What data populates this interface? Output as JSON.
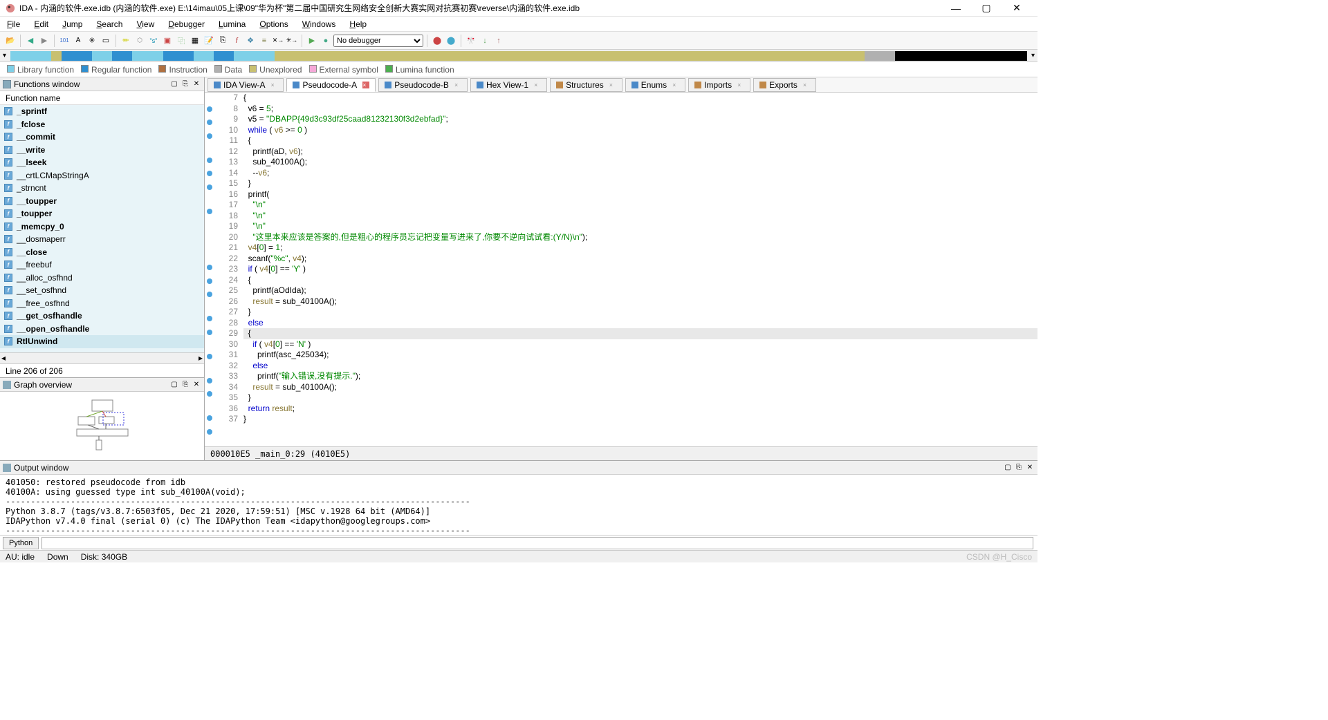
{
  "title": "IDA - 内涵的软件.exe.idb (内涵的软件.exe) E:\\14imau\\05上课\\09\"华为杯\"第二届中国研究生网络安全创新大赛实网对抗赛初赛\\reverse\\内涵的软件.exe.idb",
  "menu": [
    "File",
    "Edit",
    "Jump",
    "Search",
    "View",
    "Debugger",
    "Lumina",
    "Options",
    "Windows",
    "Help"
  ],
  "debugger_sel": "No debugger",
  "legend": [
    {
      "c": "#7ed0e8",
      "t": "Library function"
    },
    {
      "c": "#2f8fd0",
      "t": "Regular function"
    },
    {
      "c": "#b07040",
      "t": "Instruction"
    },
    {
      "c": "#b0b0b0",
      "t": "Data"
    },
    {
      "c": "#c8c070",
      "t": "Unexplored"
    },
    {
      "c": "#f5a8d8",
      "t": "External symbol"
    },
    {
      "c": "#4caf50",
      "t": "Lumina function"
    }
  ],
  "panels": {
    "functions": "Functions window",
    "graph": "Graph overview",
    "output": "Output window"
  },
  "func_col": "Function name",
  "functions": [
    {
      "n": "_sprintf",
      "b": true
    },
    {
      "n": "_fclose",
      "b": true
    },
    {
      "n": "__commit",
      "b": true
    },
    {
      "n": "__write",
      "b": true
    },
    {
      "n": "__lseek",
      "b": true
    },
    {
      "n": "__crtLCMapStringA",
      "b": false
    },
    {
      "n": "_strncnt",
      "b": false
    },
    {
      "n": "__toupper",
      "b": true
    },
    {
      "n": "_toupper",
      "b": true
    },
    {
      "n": "_memcpy_0",
      "b": true
    },
    {
      "n": "__dosmaperr",
      "b": false
    },
    {
      "n": "__close",
      "b": true
    },
    {
      "n": "__freebuf",
      "b": false
    },
    {
      "n": "__alloc_osfhnd",
      "b": false
    },
    {
      "n": "__set_osfhnd",
      "b": false
    },
    {
      "n": "__free_osfhnd",
      "b": false
    },
    {
      "n": "__get_osfhandle",
      "b": true
    },
    {
      "n": "__open_osfhandle",
      "b": true
    },
    {
      "n": "RtlUnwind",
      "b": true
    }
  ],
  "func_status": "Line 206 of 206",
  "tabs": [
    {
      "l": "IDA View-A",
      "i": "#4a89c8"
    },
    {
      "l": "Pseudocode-A",
      "i": "#4a89c8",
      "active": true,
      "closeRed": true
    },
    {
      "l": "Pseudocode-B",
      "i": "#4a89c8"
    },
    {
      "l": "Hex View-1",
      "i": "#4a89c8"
    },
    {
      "l": "Structures",
      "i": "#c08848"
    },
    {
      "l": "Enums",
      "i": "#4a89c8"
    },
    {
      "l": "Imports",
      "i": "#c08848"
    },
    {
      "l": "Exports",
      "i": "#c08848"
    }
  ],
  "code": {
    "start": 7,
    "dots": [
      8,
      9,
      10,
      12,
      13,
      14,
      16,
      21,
      22,
      23,
      25,
      26,
      28,
      30,
      31,
      33,
      34,
      36,
      37
    ],
    "lines": [
      {
        "seg": [
          {
            "t": "{",
            "c": ""
          }
        ]
      },
      {
        "seg": [
          {
            "t": "  v6 = ",
            "c": ""
          },
          {
            "t": "5",
            "c": "num"
          },
          {
            "t": ";",
            "c": ""
          }
        ]
      },
      {
        "seg": [
          {
            "t": "  v5 = ",
            "c": ""
          },
          {
            "t": "\"DBAPP{49d3c93df25caad81232130f3d2ebfad}\"",
            "c": "str"
          },
          {
            "t": ";",
            "c": ""
          }
        ]
      },
      {
        "seg": [
          {
            "t": "  ",
            "c": ""
          },
          {
            "t": "while",
            "c": "kw"
          },
          {
            "t": " ( ",
            "c": ""
          },
          {
            "t": "v6",
            "c": "var"
          },
          {
            "t": " >= ",
            "c": ""
          },
          {
            "t": "0",
            "c": "num"
          },
          {
            "t": " )",
            "c": ""
          }
        ]
      },
      {
        "seg": [
          {
            "t": "  {",
            "c": ""
          }
        ]
      },
      {
        "seg": [
          {
            "t": "    printf(aD, ",
            "c": ""
          },
          {
            "t": "v6",
            "c": "var"
          },
          {
            "t": ");",
            "c": ""
          }
        ]
      },
      {
        "seg": [
          {
            "t": "    sub_40100A();",
            "c": ""
          }
        ]
      },
      {
        "seg": [
          {
            "t": "    --",
            "c": ""
          },
          {
            "t": "v6",
            "c": "var"
          },
          {
            "t": ";",
            "c": ""
          }
        ]
      },
      {
        "seg": [
          {
            "t": "  }",
            "c": ""
          }
        ]
      },
      {
        "seg": [
          {
            "t": "  printf(",
            "c": ""
          }
        ]
      },
      {
        "seg": [
          {
            "t": "    ",
            "c": ""
          },
          {
            "t": "\"\\n\"",
            "c": "str"
          }
        ]
      },
      {
        "seg": [
          {
            "t": "    ",
            "c": ""
          },
          {
            "t": "\"\\n\"",
            "c": "str"
          }
        ]
      },
      {
        "seg": [
          {
            "t": "    ",
            "c": ""
          },
          {
            "t": "\"\\n\"",
            "c": "str"
          }
        ]
      },
      {
        "seg": [
          {
            "t": "    ",
            "c": ""
          },
          {
            "t": "\"这里本来应该是答案的,但是粗心的程序员忘记把变量写进来了,你要不逆向试试看:(Y/N)\\n\"",
            "c": "str"
          },
          {
            "t": ");",
            "c": ""
          }
        ]
      },
      {
        "seg": [
          {
            "t": "  ",
            "c": ""
          },
          {
            "t": "v4",
            "c": "var"
          },
          {
            "t": "[",
            "c": ""
          },
          {
            "t": "0",
            "c": "num"
          },
          {
            "t": "] = ",
            "c": ""
          },
          {
            "t": "1",
            "c": "num"
          },
          {
            "t": ";",
            "c": ""
          }
        ]
      },
      {
        "seg": [
          {
            "t": "  scanf(",
            "c": ""
          },
          {
            "t": "\"%c\"",
            "c": "str"
          },
          {
            "t": ", ",
            "c": ""
          },
          {
            "t": "v4",
            "c": "var"
          },
          {
            "t": ");",
            "c": ""
          }
        ]
      },
      {
        "seg": [
          {
            "t": "  ",
            "c": ""
          },
          {
            "t": "if",
            "c": "kw"
          },
          {
            "t": " ( ",
            "c": ""
          },
          {
            "t": "v4",
            "c": "var"
          },
          {
            "t": "[",
            "c": ""
          },
          {
            "t": "0",
            "c": "num"
          },
          {
            "t": "] == ",
            "c": ""
          },
          {
            "t": "'Y'",
            "c": "num"
          },
          {
            "t": " )",
            "c": ""
          }
        ]
      },
      {
        "seg": [
          {
            "t": "  {",
            "c": ""
          }
        ]
      },
      {
        "seg": [
          {
            "t": "    printf(aOdIda);",
            "c": ""
          }
        ]
      },
      {
        "seg": [
          {
            "t": "    ",
            "c": ""
          },
          {
            "t": "result",
            "c": "var"
          },
          {
            "t": " = sub_40100A();",
            "c": ""
          }
        ]
      },
      {
        "seg": [
          {
            "t": "  }",
            "c": ""
          }
        ]
      },
      {
        "seg": [
          {
            "t": "  ",
            "c": ""
          },
          {
            "t": "else",
            "c": "kw"
          }
        ]
      },
      {
        "seg": [
          {
            "t": "  {",
            "c": ""
          }
        ],
        "hl": true
      },
      {
        "seg": [
          {
            "t": "    ",
            "c": ""
          },
          {
            "t": "if",
            "c": "kw"
          },
          {
            "t": " ( ",
            "c": ""
          },
          {
            "t": "v4",
            "c": "var"
          },
          {
            "t": "[",
            "c": ""
          },
          {
            "t": "0",
            "c": "num"
          },
          {
            "t": "] == ",
            "c": ""
          },
          {
            "t": "'N'",
            "c": "num"
          },
          {
            "t": " )",
            "c": ""
          }
        ]
      },
      {
        "seg": [
          {
            "t": "      printf(asc_425034);",
            "c": ""
          }
        ]
      },
      {
        "seg": [
          {
            "t": "    ",
            "c": ""
          },
          {
            "t": "else",
            "c": "kw"
          }
        ]
      },
      {
        "seg": [
          {
            "t": "      printf(",
            "c": ""
          },
          {
            "t": "\"输入错误,没有提示.\"",
            "c": "str"
          },
          {
            "t": ");",
            "c": ""
          }
        ]
      },
      {
        "seg": [
          {
            "t": "    ",
            "c": ""
          },
          {
            "t": "result",
            "c": "var"
          },
          {
            "t": " = sub_40100A();",
            "c": ""
          }
        ]
      },
      {
        "seg": [
          {
            "t": "  }",
            "c": ""
          }
        ]
      },
      {
        "seg": [
          {
            "t": "  ",
            "c": ""
          },
          {
            "t": "return",
            "c": "kw"
          },
          {
            "t": " ",
            "c": ""
          },
          {
            "t": "result",
            "c": "var"
          },
          {
            "t": ";",
            "c": ""
          }
        ]
      },
      {
        "seg": [
          {
            "t": "}",
            "c": ""
          }
        ]
      }
    ]
  },
  "code_status": "000010E5 _main_0:29 (4010E5)",
  "output": "401050: restored pseudocode from idb\n40100A: using guessed type int sub_40100A(void);\n---------------------------------------------------------------------------------------------\nPython 3.8.7 (tags/v3.8.7:6503f05, Dec 21 2020, 17:59:51) [MSC v.1928 64 bit (AMD64)]\nIDAPython v7.4.0 final (serial 0) (c) The IDAPython Team <idapython@googlegroups.com>\n---------------------------------------------------------------------------------------------",
  "py_btn": "Python",
  "status": {
    "au": "AU:  idle",
    "down": "Down",
    "disk": "Disk: 340GB",
    "right": "CSDN @H_Cisco"
  },
  "navsegs": [
    {
      "w": 4,
      "c": "#7ed0e8"
    },
    {
      "w": 1,
      "c": "#c8c070"
    },
    {
      "w": 3,
      "c": "#2f8fd0"
    },
    {
      "w": 2,
      "c": "#7ed0e8"
    },
    {
      "w": 2,
      "c": "#2f8fd0"
    },
    {
      "w": 3,
      "c": "#7ed0e8"
    },
    {
      "w": 3,
      "c": "#2f8fd0"
    },
    {
      "w": 2,
      "c": "#7ed0e8"
    },
    {
      "w": 2,
      "c": "#2f8fd0"
    },
    {
      "w": 4,
      "c": "#7ed0e8"
    },
    {
      "w": 48,
      "c": "#c8c070"
    },
    {
      "w": 10,
      "c": "#c8c070"
    },
    {
      "w": 3,
      "c": "#b0b0b0"
    },
    {
      "w": 13,
      "c": "#000"
    }
  ]
}
